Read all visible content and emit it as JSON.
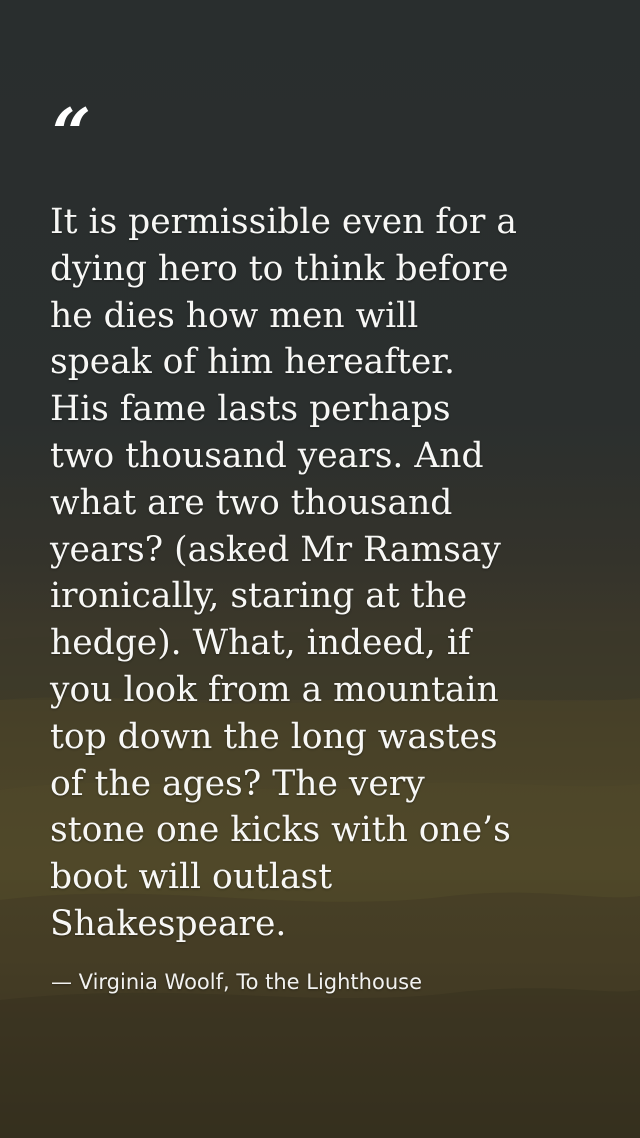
{
  "quote": {
    "mark": "“",
    "text": "It is permissible even for a\ndying hero to think before\nhe dies how men will\nspeak of him hereafter.\nHis fame lasts perhaps\ntwo thousand years. And\nwhat are two thousand\nyears? (asked Mr Ramsay\nironically, staring at the\nhedge). What, indeed, if\nyou look from a mountain\ntop down the long wastes\nof the ages? The very\nstone one kicks with one’s\nboot will outlast\nShakespeare.",
    "attribution": "— Virginia Woolf, To the Lighthouse"
  },
  "colors": {
    "text": "#f7f7f5",
    "sky": "#2b2f2e",
    "land": "#4f4828"
  }
}
